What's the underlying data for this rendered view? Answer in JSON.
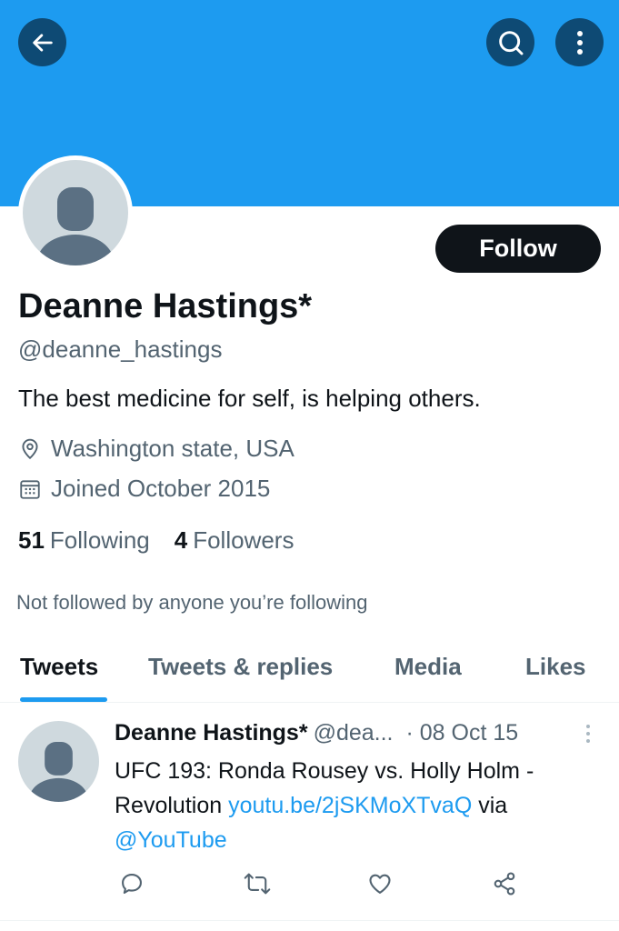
{
  "profile": {
    "name": "Deanne Hastings*",
    "handle": "@deanne_hastings",
    "bio": "The best medicine for self, is helping others.",
    "location": "Washington state, USA",
    "joined": "Joined October 2015",
    "following_count": "51",
    "following_label": "Following",
    "followers_count": "4",
    "followers_label": "Followers",
    "not_followed_text": "Not followed by anyone you’re following",
    "follow_label": "Follow"
  },
  "tabs": [
    {
      "label": "Tweets",
      "active": true
    },
    {
      "label": "Tweets & replies",
      "active": false
    },
    {
      "label": "Media",
      "active": false
    },
    {
      "label": "Likes",
      "active": false
    }
  ],
  "tweet": {
    "name": "Deanne Hastings*",
    "handle": "@dea...",
    "date": "· 08 Oct 15",
    "text_part1": "UFC 193: Ronda Rousey vs. Holly Holm - Revolution ",
    "link": "youtu.be/2jSKMoXTvaQ",
    "text_part2": " via ",
    "mention": "@YouTube"
  },
  "icons": {
    "back": "arrow-left-icon",
    "search": "search-icon",
    "more": "more-vertical-icon",
    "location": "location-pin-icon",
    "calendar": "calendar-icon",
    "reply": "reply-icon",
    "retweet": "retweet-icon",
    "like": "heart-icon",
    "share": "share-icon"
  },
  "colors": {
    "accent": "#1d9bf0",
    "text": "#0f1419",
    "secondary": "#536471",
    "button_dark": "#0e4a74"
  }
}
